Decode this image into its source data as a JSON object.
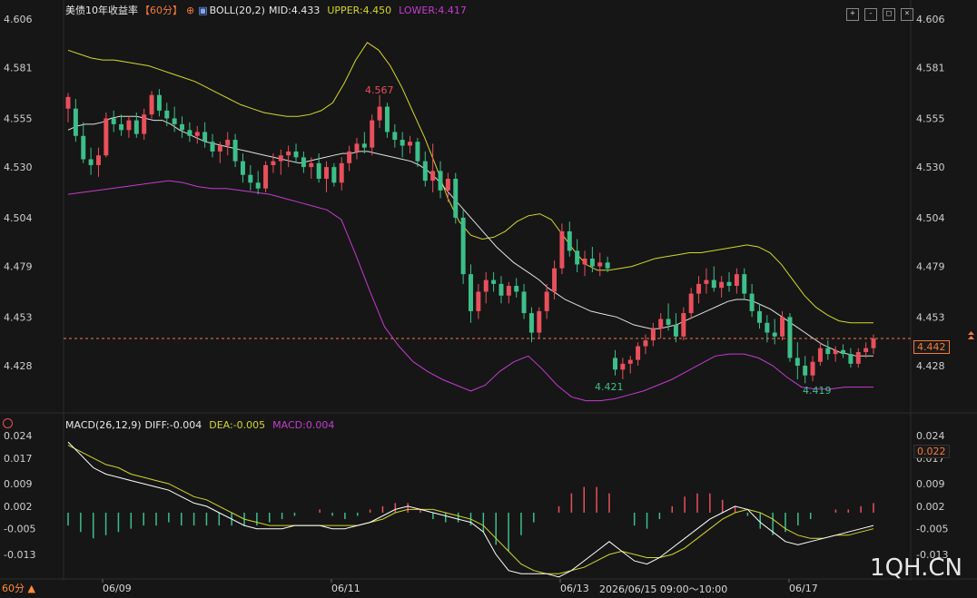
{
  "instrument": {
    "name": "美债10年收益率",
    "period_tag": "【60分】",
    "bolL_label": "BOLL(20,2)",
    "mid": "MID:4.433",
    "upper": "UPPER:4.450",
    "lower": "LOWER:4.417"
  },
  "macd": {
    "label": "MACD(26,12,9)",
    "diff": "DIFF:-0.004",
    "dea": "DEA:-0.005",
    "macd": "MACD:0.004"
  },
  "current_price_tag": "4.442",
  "current_macd_tag": "0.022",
  "crosshair_time": "2026/06/15 09:00～10:00",
  "period_selector": "60分 ▲",
  "watermark": "1QH.CN",
  "annotations": {
    "high": "4.567",
    "low1": "4.421",
    "low2": "4.419"
  },
  "colors": {
    "up": "#e8505b",
    "down": "#3dbf8a",
    "mid": "#e0e0e0",
    "upper": "#d6d62a",
    "lower": "#c43ccf",
    "diff": "#ffffff",
    "dea": "#d6d62a",
    "accent": "#f47a3c"
  },
  "chart_data": [
    {
      "type": "candlestick",
      "title": "美债10年收益率【60分】",
      "y_ticks": [
        "4.606",
        "4.581",
        "4.555",
        "4.530",
        "4.504",
        "4.479",
        "4.453",
        "4.428"
      ],
      "x_ticks": [
        "06/09",
        "06/11",
        "06/13",
        "06/17"
      ],
      "ylim": [
        4.403,
        4.606
      ],
      "current_level": 4.442,
      "candles": [
        [
          4.56,
          4.568,
          4.553,
          4.566
        ],
        [
          4.56,
          4.565,
          4.543,
          4.546
        ],
        [
          4.546,
          4.553,
          4.532,
          4.534
        ],
        [
          4.534,
          4.54,
          4.526,
          4.531
        ],
        [
          4.531,
          4.54,
          4.525,
          4.536
        ],
        [
          4.536,
          4.558,
          4.535,
          4.555
        ],
        [
          4.555,
          4.559,
          4.548,
          4.552
        ],
        [
          4.552,
          4.557,
          4.546,
          4.549
        ],
        [
          4.549,
          4.556,
          4.545,
          4.554
        ],
        [
          4.554,
          4.558,
          4.545,
          4.547
        ],
        [
          4.547,
          4.56,
          4.544,
          4.557
        ],
        [
          4.557,
          4.569,
          4.555,
          4.567
        ],
        [
          4.567,
          4.57,
          4.556,
          4.559
        ],
        [
          4.559,
          4.563,
          4.551,
          4.555
        ],
        [
          4.555,
          4.561,
          4.548,
          4.552
        ],
        [
          4.552,
          4.556,
          4.545,
          4.549
        ],
        [
          4.549,
          4.553,
          4.543,
          4.546
        ],
        [
          4.546,
          4.551,
          4.542,
          4.548
        ],
        [
          4.548,
          4.553,
          4.54,
          4.543
        ],
        [
          4.543,
          4.547,
          4.535,
          4.538
        ],
        [
          4.538,
          4.543,
          4.532,
          4.541
        ],
        [
          4.541,
          4.548,
          4.536,
          4.544
        ],
        [
          4.544,
          4.547,
          4.53,
          4.533
        ],
        [
          4.533,
          4.537,
          4.522,
          4.526
        ],
        [
          4.526,
          4.531,
          4.518,
          4.522
        ],
        [
          4.522,
          4.528,
          4.516,
          4.519
        ],
        [
          4.519,
          4.533,
          4.517,
          4.531
        ],
        [
          4.531,
          4.537,
          4.527,
          4.533
        ],
        [
          4.533,
          4.539,
          4.526,
          4.536
        ],
        [
          4.536,
          4.541,
          4.53,
          4.538
        ],
        [
          4.538,
          4.542,
          4.532,
          4.535
        ],
        [
          4.535,
          4.538,
          4.527,
          4.53
        ],
        [
          4.53,
          4.535,
          4.524,
          4.532
        ],
        [
          4.532,
          4.537,
          4.522,
          4.524
        ],
        [
          4.524,
          4.533,
          4.517,
          4.53
        ],
        [
          4.53,
          4.532,
          4.52,
          4.522
        ],
        [
          4.522,
          4.535,
          4.518,
          4.532
        ],
        [
          4.532,
          4.541,
          4.528,
          4.538
        ],
        [
          4.538,
          4.545,
          4.534,
          4.542
        ],
        [
          4.542,
          4.548,
          4.537,
          4.54
        ],
        [
          4.54,
          4.557,
          4.536,
          4.554
        ],
        [
          4.554,
          4.567,
          4.55,
          4.561
        ],
        [
          4.561,
          4.563,
          4.545,
          4.548
        ],
        [
          4.548,
          4.552,
          4.54,
          4.544
        ],
        [
          4.544,
          4.548,
          4.535,
          4.541
        ],
        [
          4.541,
          4.546,
          4.537,
          4.543
        ],
        [
          4.543,
          4.545,
          4.53,
          4.533
        ],
        [
          4.533,
          4.538,
          4.52,
          4.523
        ],
        [
          4.523,
          4.542,
          4.517,
          4.528
        ],
        [
          4.528,
          4.533,
          4.514,
          4.518
        ],
        [
          4.518,
          4.527,
          4.512,
          4.524
        ],
        [
          4.524,
          4.527,
          4.501,
          4.504
        ],
        [
          4.504,
          4.508,
          4.47,
          4.475
        ],
        [
          4.475,
          4.48,
          4.45,
          4.456
        ],
        [
          4.456,
          4.47,
          4.452,
          4.466
        ],
        [
          4.466,
          4.476,
          4.46,
          4.472
        ],
        [
          4.472,
          4.476,
          4.466,
          4.47
        ],
        [
          4.47,
          4.474,
          4.46,
          4.464
        ],
        [
          4.464,
          4.471,
          4.46,
          4.469
        ],
        [
          4.469,
          4.473,
          4.463,
          4.466
        ],
        [
          4.466,
          4.47,
          4.452,
          4.455
        ],
        [
          4.455,
          4.458,
          4.44,
          4.445
        ],
        [
          4.445,
          4.458,
          4.442,
          4.456
        ],
        [
          4.456,
          4.47,
          4.452,
          4.466
        ],
        [
          4.466,
          4.482,
          4.462,
          4.478
        ],
        [
          4.478,
          4.501,
          4.475,
          4.497
        ],
        [
          4.497,
          4.502,
          4.484,
          4.487
        ],
        [
          4.487,
          4.493,
          4.476,
          4.48
        ],
        [
          4.48,
          4.487,
          4.474,
          4.483
        ],
        [
          4.483,
          4.489,
          4.476,
          4.479
        ],
        [
          4.479,
          4.486,
          4.474,
          4.481
        ],
        [
          4.481,
          4.484,
          4.476,
          4.478
        ],
        [
          4.432,
          4.436,
          4.423,
          4.426
        ],
        [
          4.426,
          4.432,
          4.421,
          4.429
        ],
        [
          4.429,
          4.433,
          4.424,
          4.431
        ],
        [
          4.431,
          4.44,
          4.428,
          4.438
        ],
        [
          4.438,
          4.444,
          4.434,
          4.441
        ],
        [
          4.441,
          4.45,
          4.438,
          4.447
        ],
        [
          4.447,
          4.455,
          4.442,
          4.452
        ],
        [
          4.452,
          4.46,
          4.446,
          4.449
        ],
        [
          4.449,
          4.455,
          4.44,
          4.443
        ],
        [
          4.443,
          4.458,
          4.441,
          4.455
        ],
        [
          4.455,
          4.468,
          4.452,
          4.465
        ],
        [
          4.465,
          4.474,
          4.46,
          4.47
        ],
        [
          4.47,
          4.478,
          4.465,
          4.472
        ],
        [
          4.472,
          4.479,
          4.466,
          4.468
        ],
        [
          4.468,
          4.474,
          4.463,
          4.471
        ],
        [
          4.471,
          4.476,
          4.466,
          4.469
        ],
        [
          4.469,
          4.478,
          4.465,
          4.475
        ],
        [
          4.475,
          4.478,
          4.462,
          4.465
        ],
        [
          4.465,
          4.47,
          4.453,
          4.456
        ],
        [
          4.456,
          4.46,
          4.447,
          4.45
        ],
        [
          4.45,
          4.454,
          4.44,
          4.445
        ],
        [
          4.445,
          4.452,
          4.439,
          4.443
        ],
        [
          4.443,
          4.456,
          4.441,
          4.453
        ],
        [
          4.453,
          4.455,
          4.43,
          4.432
        ],
        [
          4.432,
          4.44,
          4.421,
          4.428
        ],
        [
          4.428,
          4.433,
          4.419,
          4.423
        ],
        [
          4.423,
          4.433,
          4.42,
          4.43
        ],
        [
          4.43,
          4.44,
          4.428,
          4.437
        ],
        [
          4.437,
          4.441,
          4.431,
          4.434
        ],
        [
          4.434,
          4.438,
          4.43,
          4.436
        ],
        [
          4.436,
          4.439,
          4.432,
          4.434
        ],
        [
          4.434,
          4.437,
          4.427,
          4.429
        ],
        [
          4.429,
          4.437,
          4.427,
          4.435
        ],
        [
          4.435,
          4.44,
          4.432,
          4.437
        ],
        [
          4.437,
          4.444,
          4.434,
          4.442
        ]
      ],
      "mid": [
        4.549,
        4.551,
        4.552,
        4.552,
        4.553,
        4.555,
        4.556,
        4.556,
        4.556,
        4.555,
        4.554,
        4.554,
        4.552,
        4.549,
        4.547,
        4.545,
        4.543,
        4.542,
        4.541,
        4.54,
        4.539,
        4.538,
        4.537,
        4.536,
        4.535,
        4.534,
        4.533,
        4.532,
        4.533,
        4.534,
        4.535,
        4.536,
        4.537,
        4.537,
        4.538,
        4.538,
        4.537,
        4.536,
        4.535,
        4.534,
        4.533,
        4.531,
        4.528,
        4.524,
        4.519,
        4.514,
        4.509,
        4.504,
        4.499,
        4.494,
        4.489,
        4.485,
        4.481,
        4.478,
        4.475,
        4.472,
        4.468,
        4.465,
        4.462,
        4.46,
        4.458,
        4.456,
        4.455,
        4.454,
        4.453,
        4.451,
        4.449,
        4.448,
        4.447,
        4.447,
        4.448,
        4.449,
        4.451,
        4.453,
        4.455,
        4.457,
        4.459,
        4.461,
        4.462,
        4.462,
        4.461,
        4.459,
        4.457,
        4.454,
        4.451,
        4.448,
        4.445,
        4.442,
        4.439,
        4.437,
        4.435,
        4.434,
        4.433,
        4.433,
        4.433
      ],
      "upper": [
        4.59,
        4.588,
        4.586,
        4.585,
        4.585,
        4.584,
        4.583,
        4.582,
        4.58,
        4.578,
        4.576,
        4.574,
        4.571,
        4.568,
        4.565,
        4.562,
        4.56,
        4.558,
        4.557,
        4.556,
        4.556,
        4.557,
        4.559,
        4.563,
        4.573,
        4.585,
        4.594,
        4.59,
        4.582,
        4.571,
        4.558,
        4.545,
        4.53,
        4.514,
        4.502,
        4.495,
        4.493,
        4.494,
        4.497,
        4.502,
        4.505,
        4.506,
        4.503,
        4.495,
        4.487,
        4.48,
        4.477,
        4.477,
        4.478,
        4.479,
        4.481,
        4.483,
        4.484,
        4.485,
        4.486,
        4.486,
        4.487,
        4.488,
        4.489,
        4.49,
        4.489,
        4.486,
        4.48,
        4.472,
        4.464,
        4.458,
        4.454,
        4.451,
        4.45,
        4.45,
        4.45
      ],
      "lower": [
        4.516,
        4.517,
        4.518,
        4.519,
        4.52,
        4.521,
        4.522,
        4.523,
        4.522,
        4.52,
        4.519,
        4.519,
        4.518,
        4.517,
        4.516,
        4.514,
        4.512,
        4.51,
        4.508,
        4.503,
        4.485,
        4.466,
        4.448,
        4.438,
        4.43,
        4.425,
        4.421,
        4.418,
        4.415,
        4.418,
        4.425,
        4.43,
        4.433,
        4.426,
        4.418,
        4.412,
        4.41,
        4.41,
        4.411,
        4.413,
        4.415,
        4.418,
        4.421,
        4.425,
        4.429,
        4.433,
        4.434,
        4.434,
        4.432,
        4.428,
        4.422,
        4.417,
        4.416,
        4.416,
        4.417,
        4.417,
        4.417
      ]
    },
    {
      "type": "bar",
      "title": "MACD(26,12,9)",
      "y_ticks": [
        "0.024",
        "0.017",
        "0.009",
        "0.002",
        "-0.005",
        "-0.013"
      ],
      "ylim": [
        -0.02,
        0.024
      ],
      "series": [
        {
          "name": "DIFF",
          "values": [
            0.022,
            0.018,
            0.014,
            0.012,
            0.011,
            0.01,
            0.009,
            0.008,
            0.007,
            0.005,
            0.003,
            0.002,
            0.0,
            -0.002,
            -0.004,
            -0.005,
            -0.005,
            -0.005,
            -0.004,
            -0.004,
            -0.004,
            -0.005,
            -0.005,
            -0.004,
            -0.003,
            -0.001,
            0.001,
            0.002,
            0.001,
            0.0,
            -0.001,
            -0.002,
            -0.003,
            -0.006,
            -0.013,
            -0.018,
            -0.019,
            -0.019,
            -0.019,
            -0.02,
            -0.018,
            -0.015,
            -0.012,
            -0.009,
            -0.012,
            -0.015,
            -0.016,
            -0.014,
            -0.011,
            -0.008,
            -0.005,
            -0.002,
            0.0,
            0.002,
            0.001,
            -0.003,
            -0.006,
            -0.009,
            -0.01,
            -0.009,
            -0.008,
            -0.007,
            -0.006,
            -0.005,
            -0.004
          ]
        },
        {
          "name": "DEA",
          "values": [
            0.021,
            0.019,
            0.017,
            0.015,
            0.014,
            0.012,
            0.011,
            0.01,
            0.009,
            0.007,
            0.005,
            0.004,
            0.002,
            0.0,
            -0.002,
            -0.003,
            -0.004,
            -0.004,
            -0.004,
            -0.004,
            -0.004,
            -0.004,
            -0.004,
            -0.004,
            -0.003,
            -0.002,
            0.0,
            0.001,
            0.001,
            0.001,
            0.0,
            -0.001,
            -0.002,
            -0.004,
            -0.008,
            -0.012,
            -0.016,
            -0.018,
            -0.019,
            -0.019,
            -0.018,
            -0.017,
            -0.015,
            -0.013,
            -0.012,
            -0.013,
            -0.014,
            -0.014,
            -0.013,
            -0.011,
            -0.008,
            -0.005,
            -0.002,
            0.0,
            0.001,
            0.0,
            -0.002,
            -0.005,
            -0.007,
            -0.008,
            -0.008,
            -0.007,
            -0.007,
            -0.006,
            -0.005
          ]
        },
        {
          "name": "MACD",
          "values": [
            -0.004,
            -0.006,
            -0.008,
            -0.007,
            -0.006,
            -0.005,
            -0.004,
            -0.004,
            -0.003,
            -0.004,
            -0.004,
            -0.004,
            -0.004,
            -0.004,
            -0.004,
            -0.004,
            -0.003,
            -0.002,
            -0.001,
            0.0,
            0.001,
            -0.001,
            -0.002,
            -0.001,
            0.001,
            0.002,
            0.003,
            0.003,
            0.001,
            -0.002,
            -0.003,
            -0.003,
            -0.004,
            -0.006,
            -0.01,
            -0.012,
            -0.007,
            -0.003,
            0.0,
            0.002,
            0.006,
            0.008,
            0.008,
            0.006,
            0.0,
            -0.004,
            -0.005,
            -0.002,
            0.002,
            0.005,
            0.006,
            0.006,
            0.004,
            0.002,
            -0.001,
            -0.005,
            -0.007,
            -0.006,
            -0.004,
            -0.002,
            0.0,
            0.001,
            0.001,
            0.002,
            0.003
          ]
        }
      ]
    }
  ]
}
